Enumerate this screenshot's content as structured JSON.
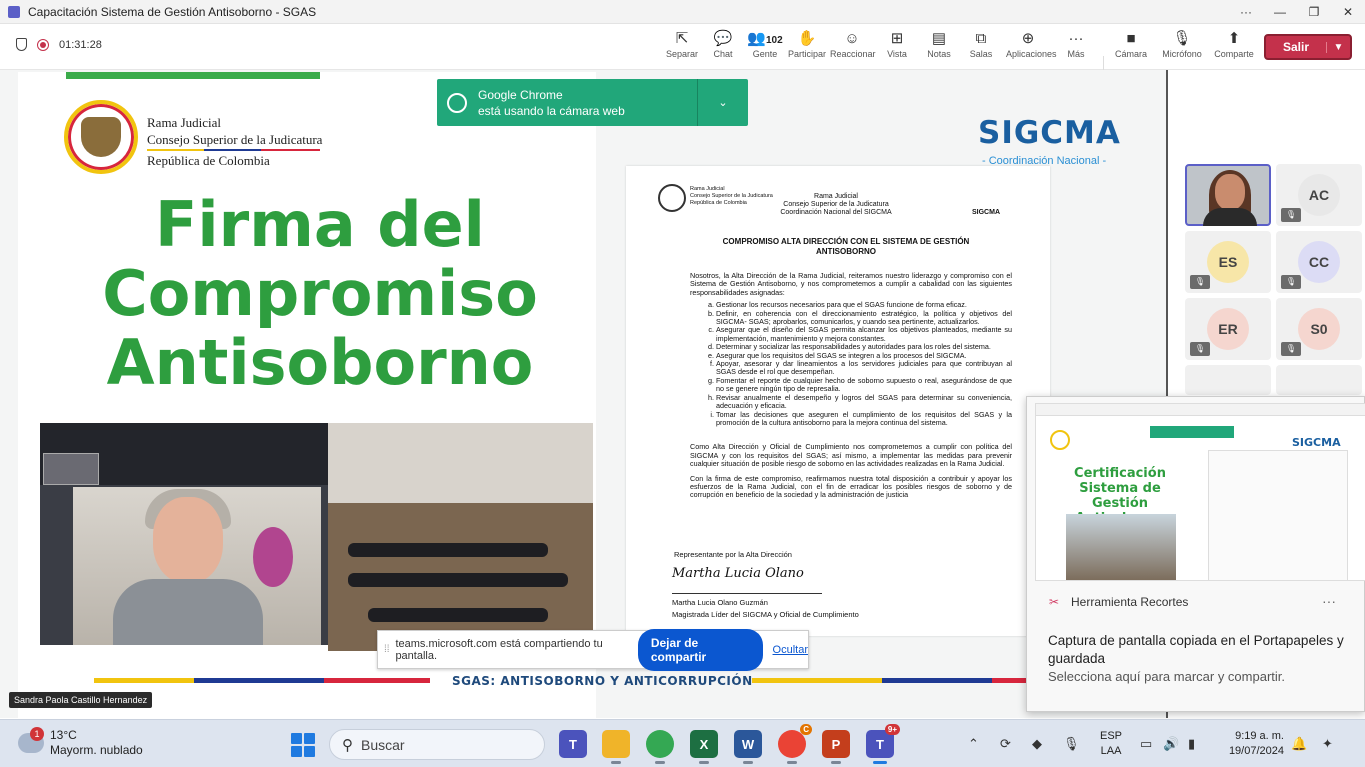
{
  "window": {
    "title": "Capacitación Sistema de Gestión Antisoborno - SGAS",
    "more": "···",
    "minimize": "—",
    "restore": "❐",
    "close": "✕"
  },
  "meeting": {
    "timer": "01:31:28",
    "controls": [
      {
        "label": "Separar",
        "icon": "⇱"
      },
      {
        "label": "Chat",
        "icon": "💬"
      },
      {
        "label": "Gente",
        "icon": "👥",
        "count": "102"
      },
      {
        "label": "Participar",
        "icon": "✋"
      },
      {
        "label": "Reaccionar",
        "icon": "☺"
      },
      {
        "label": "Vista",
        "icon": "⊞"
      },
      {
        "label": "Notas",
        "icon": "▤"
      },
      {
        "label": "Salas",
        "icon": "⧉"
      },
      {
        "label": "Aplicaciones",
        "icon": "⊕"
      },
      {
        "label": "Más",
        "icon": "···"
      }
    ],
    "media": [
      {
        "label": "Cámara",
        "icon": "■"
      },
      {
        "label": "Micrófono",
        "icon": "🎙"
      },
      {
        "label": "Comparte",
        "icon": "⬆"
      }
    ],
    "leave_label": "Salir"
  },
  "slide": {
    "org_lines": [
      "Rama Judicial",
      "Consejo Superior de la Judicatura",
      "República de Colombia"
    ],
    "title_lines": [
      "Firma del",
      "Compromiso",
      "Antisoborno"
    ],
    "brand": "SIGCMA",
    "brand_sub": "- Coordinación Nacional -",
    "footer": "SGAS: ANTISOBORNO Y ANTICORRUPCIÓN"
  },
  "document": {
    "header_left": [
      "Rama Judicial",
      "Consejo Superior de la Judicatura",
      "República de Colombia"
    ],
    "header_center": [
      "Rama Judicial",
      "Consejo Superior de la Judicatura",
      "Coordinación Nacional del SIGCMA"
    ],
    "header_right": "SIGCMA",
    "title": "COMPROMISO ALTA DIRECCIÓN CON EL SISTEMA DE GESTIÓN ANTISOBORNO",
    "intro": "Nosotros, la Alta Dirección de la Rama Judicial, reiteramos nuestro liderazgo y compromiso con el Sistema de Gestión Antisoborno, y nos comprometemos a cumplir a cabalidad con las siguientes responsabilidades asignadas:",
    "items": [
      "Gestionar los recursos necesarios para que el SGAS funcione de forma eficaz.",
      "Definir, en coherencia con el direccionamiento estratégico, la política y objetivos del SIGCMA- SGAS; aprobarlos, comunicarlos, y cuando sea pertinente, actualizarlos.",
      "Asegurar que el diseño del SGAS permita alcanzar los objetivos planteados, mediante su implementación, mantenimiento y mejora constantes.",
      "Determinar y socializar las responsabilidades y autoridades para los roles del sistema.",
      "Asegurar que los requisitos del SGAS se integren a los procesos del SIGCMA.",
      "Apoyar, asesorar y dar lineamientos a los servidores judiciales para que contribuyan al SGAS desde el rol que desempeñan.",
      "Fomentar el reporte de cualquier hecho de soborno supuesto o real, asegurándose de que no se genere ningún tipo de represalia.",
      "Revisar anualmente el desempeño y logros del SGAS para determinar su conveniencia, adecuación y eficacia.",
      "Tomar las decisiones que aseguren el cumplimiento de los requisitos del SGAS y la promoción de la cultura antisoborno para la mejora continua del sistema."
    ],
    "para2": "Como Alta Dirección y Oficial de Cumplimiento nos comprometemos a cumplir con política del SIGCMA y con los requisitos del SGAS; así mismo, a implementar las medidas para prevenir cualquier situación de posible riesgo de soborno en las actividades realizadas en la Rama Judicial.",
    "para3": "Con la firma de este compromiso, reafirmamos nuestra total disposición a contribuir y apoyar los esfuerzos de la Rama Judicial, con el fin de erradicar los posibles riesgos de soborno y de corrupción en beneficio de la sociedad y la administración de justicia",
    "rep": "Representante por la Alta Dirección",
    "signature": "Martha Lucia Olano",
    "name": "Martha Lucia Olano Guzmán",
    "role": "Magistrada Líder del SIGCMA y Oficial de Cumplimiento"
  },
  "chrome_notice": {
    "line1": "Google Chrome",
    "line2": "está usando la cámara web",
    "chevron": "⌄"
  },
  "share_bar": {
    "message": "teams.microsoft.com está compartiendo tu pantalla.",
    "stop": "Dejar de compartir",
    "hide": "Ocultar"
  },
  "speaker_name": "Sandra Paola Castillo Hernandez",
  "participants": [
    "AC",
    "ES",
    "CC",
    "ER",
    "S0"
  ],
  "snip": {
    "app": "Herramienta Recortes",
    "more": "···",
    "message": "Captura de pantalla copiada en el Portapapeles y guardada",
    "sub": "Selecciona aquí para marcar y compartir.",
    "preview_title": "Certificación Sistema de Gestión Antisoborno",
    "preview_brand": "SIGCMA"
  },
  "taskbar": {
    "weather_temp": "13°C",
    "weather_desc": "Mayorm. nublado",
    "weather_badge": "1",
    "search": "Buscar",
    "lang1": "ESP",
    "lang2": "LAA",
    "time": "9:19 a. m.",
    "date": "19/07/2024",
    "teams_badge": "9+",
    "chrome_badge": "C"
  }
}
